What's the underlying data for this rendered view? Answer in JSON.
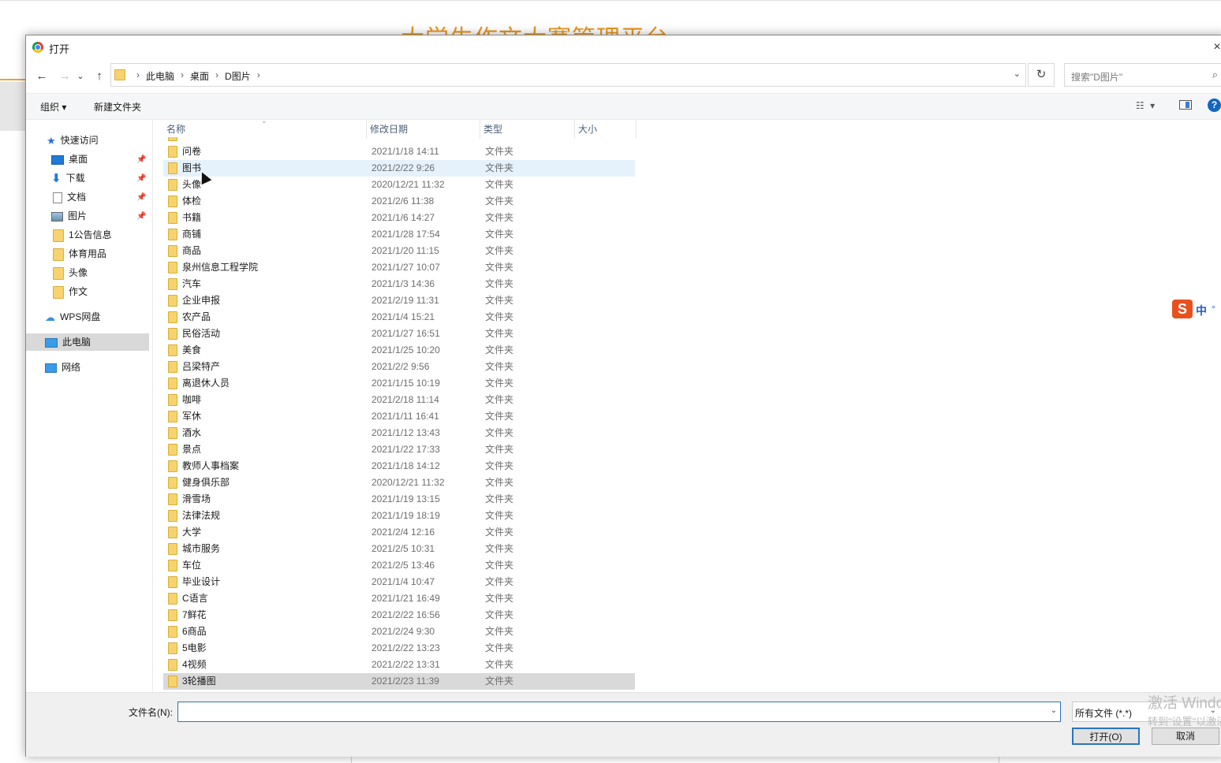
{
  "background": {
    "page_title": "大学生作文大赛管理平台"
  },
  "dialog": {
    "title": "打开",
    "close_label": "×",
    "nav": {
      "back": "←",
      "forward": "→",
      "recent": "⌄",
      "up": "↑"
    },
    "breadcrumb": [
      "此电脑",
      "桌面",
      "D图片"
    ],
    "refresh_label": "↻",
    "search_placeholder": "搜索\"D图片\"",
    "toolbar": {
      "organize": "组织 ▾",
      "new_folder": "新建文件夹",
      "help": "?"
    },
    "sidebar": {
      "quick_access": "快速访问",
      "items": [
        {
          "label": "桌面",
          "icon": "desktop-icon",
          "pinned": true
        },
        {
          "label": "下载",
          "icon": "download-icon",
          "pinned": true
        },
        {
          "label": "文档",
          "icon": "document-icon",
          "pinned": true
        },
        {
          "label": "图片",
          "icon": "picture-icon",
          "pinned": true
        },
        {
          "label": "1公告信息",
          "icon": "folder-icon",
          "pinned": false
        },
        {
          "label": "体育用品",
          "icon": "folder-icon",
          "pinned": false
        },
        {
          "label": "头像",
          "icon": "folder-icon",
          "pinned": false
        },
        {
          "label": "作文",
          "icon": "folder-icon",
          "pinned": false
        }
      ],
      "wps": "WPS网盘",
      "this_pc": "此电脑",
      "network": "网络"
    },
    "columns": {
      "name": "名称",
      "date": "修改日期",
      "type": "类型",
      "size": "大小"
    },
    "files": [
      {
        "name": "问卷",
        "date": "2021/1/18 14:11",
        "type": "文件夹"
      },
      {
        "name": "图书",
        "date": "2021/2/22 9:26",
        "type": "文件夹"
      },
      {
        "name": "头像",
        "date": "2020/12/21 11:32",
        "type": "文件夹"
      },
      {
        "name": "体检",
        "date": "2021/2/6 11:38",
        "type": "文件夹"
      },
      {
        "name": "书籍",
        "date": "2021/1/6 14:27",
        "type": "文件夹"
      },
      {
        "name": "商铺",
        "date": "2021/1/28 17:54",
        "type": "文件夹"
      },
      {
        "name": "商品",
        "date": "2021/1/20 11:15",
        "type": "文件夹"
      },
      {
        "name": "泉州信息工程学院",
        "date": "2021/1/27 10:07",
        "type": "文件夹"
      },
      {
        "name": "汽车",
        "date": "2021/1/3 14:36",
        "type": "文件夹"
      },
      {
        "name": "企业申报",
        "date": "2021/2/19 11:31",
        "type": "文件夹"
      },
      {
        "name": "农产品",
        "date": "2021/1/4 15:21",
        "type": "文件夹"
      },
      {
        "name": "民俗活动",
        "date": "2021/1/27 16:51",
        "type": "文件夹"
      },
      {
        "name": "美食",
        "date": "2021/1/25 10:20",
        "type": "文件夹"
      },
      {
        "name": "吕梁特产",
        "date": "2021/2/2 9:56",
        "type": "文件夹"
      },
      {
        "name": "离退休人员",
        "date": "2021/1/15 10:19",
        "type": "文件夹"
      },
      {
        "name": "咖啡",
        "date": "2021/2/18 11:14",
        "type": "文件夹"
      },
      {
        "name": "军休",
        "date": "2021/1/11 16:41",
        "type": "文件夹"
      },
      {
        "name": "酒水",
        "date": "2021/1/12 13:43",
        "type": "文件夹"
      },
      {
        "name": "景点",
        "date": "2021/1/22 17:33",
        "type": "文件夹"
      },
      {
        "name": "教师人事档案",
        "date": "2021/1/18 14:12",
        "type": "文件夹"
      },
      {
        "name": "健身俱乐部",
        "date": "2020/12/21 11:32",
        "type": "文件夹"
      },
      {
        "name": "滑雪场",
        "date": "2021/1/19 13:15",
        "type": "文件夹"
      },
      {
        "name": "法律法规",
        "date": "2021/1/19 18:19",
        "type": "文件夹"
      },
      {
        "name": "大学",
        "date": "2021/2/4 12:16",
        "type": "文件夹"
      },
      {
        "name": "城市服务",
        "date": "2021/2/5 10:31",
        "type": "文件夹"
      },
      {
        "name": "车位",
        "date": "2021/2/5 13:46",
        "type": "文件夹"
      },
      {
        "name": "毕业设计",
        "date": "2021/1/4 10:47",
        "type": "文件夹"
      },
      {
        "name": "C语言",
        "date": "2021/1/21 16:49",
        "type": "文件夹"
      },
      {
        "name": "7鲜花",
        "date": "2021/2/22 16:56",
        "type": "文件夹"
      },
      {
        "name": "6商品",
        "date": "2021/2/24 9:30",
        "type": "文件夹"
      },
      {
        "name": "5电影",
        "date": "2021/2/22 13:23",
        "type": "文件夹"
      },
      {
        "name": "4视频",
        "date": "2021/2/22 13:31",
        "type": "文件夹"
      },
      {
        "name": "3轮播图",
        "date": "2021/2/23 11:39",
        "type": "文件夹"
      }
    ],
    "hover_index": 1,
    "selected_index": 32,
    "filename_label": "文件名(N):",
    "filename_value": "",
    "filter_label": "所有文件 (*.*)",
    "open_button": "打开(O)",
    "cancel_button": "取消",
    "watermark_line1": "激活 Windows",
    "watermark_line2": "转到\"设置\"以激活 Windows。"
  },
  "ime": {
    "logo": "S",
    "mode": "中",
    "dot": "°"
  }
}
